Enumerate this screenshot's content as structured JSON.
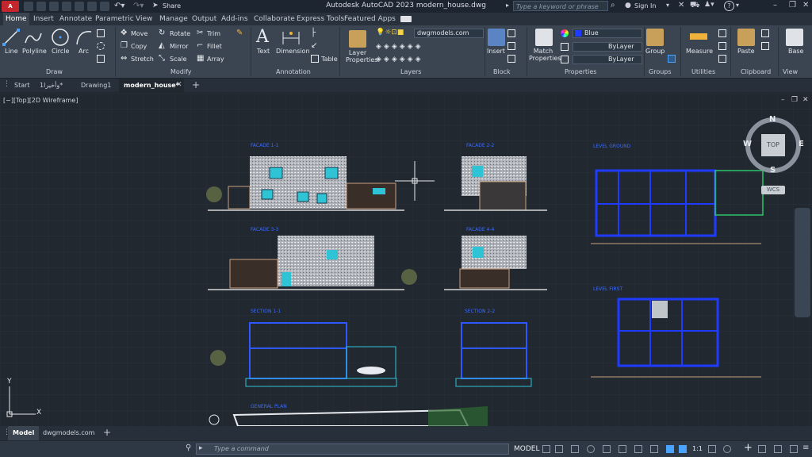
{
  "titlebar": {
    "logo": "A CAD",
    "title": "Autodesk AutoCAD 2023    modern_house.dwg",
    "share_label": "Share",
    "search_placeholder": "Type a keyword or phrase",
    "signin_label": "Sign In"
  },
  "ribbon_tabs": [
    "Home",
    "Insert",
    "Annotate",
    "Parametric",
    "View",
    "Manage",
    "Output",
    "Add-ins",
    "Collaborate",
    "Express Tools",
    "Featured Apps"
  ],
  "draw": {
    "title": "Draw",
    "line": "Line",
    "polyline": "Polyline",
    "circle": "Circle",
    "arc": "Arc"
  },
  "modify": {
    "title": "Modify",
    "move": "Move",
    "rotate": "Rotate",
    "trim": "Trim",
    "copy": "Copy",
    "mirror": "Mirror",
    "fillet": "Fillet",
    "stretch": "Stretch",
    "scale": "Scale",
    "array": "Array"
  },
  "annotation": {
    "title": "Annotation",
    "text": "Text",
    "dimension": "Dimension",
    "table": "Table"
  },
  "layers": {
    "title": "Layers",
    "layer_properties": "Layer Properties",
    "current_layer": "dwgmodels.com"
  },
  "block": {
    "title": "Block",
    "insert": "Insert"
  },
  "properties": {
    "title": "Properties",
    "match": "Match Properties",
    "color": "Blue",
    "linetype": "ByLayer",
    "lineweight": "ByLayer"
  },
  "groups": {
    "title": "Groups",
    "group": "Group"
  },
  "utilities": {
    "title": "Utilities",
    "measure": "Measure"
  },
  "clipboard": {
    "title": "Clipboard",
    "paste": "Paste"
  },
  "view": {
    "title": "View",
    "base": "Base"
  },
  "file_tabs": [
    "Start",
    "1وأخيرا*",
    "Drawing1",
    "modern_house*"
  ],
  "viewport_label": "[−][Top][2D Wireframe]",
  "viewcube": {
    "n": "N",
    "s": "S",
    "e": "E",
    "w": "W",
    "top": "TOP",
    "wcs": "WCS"
  },
  "drawing_labels": {
    "facade_1": "FACADE 1-1",
    "facade_2": "FACADE 2-2",
    "facade_3": "FACADE 3-3",
    "facade_4": "FACADE 4-4",
    "section_1": "SECTION 1-1",
    "section_2": "SECTION 2-2",
    "ground_floor": "LEVEL GROUND",
    "first_floor": "LEVEL FIRST",
    "general_plan": "GENERAL PLAN"
  },
  "ucs": {
    "x": "X",
    "y": "Y"
  },
  "layout_tabs": [
    "Model",
    "dwgmodels.com"
  ],
  "status": {
    "command_placeholder": "Type a command",
    "model": "MODEL",
    "scale": "1:1"
  }
}
